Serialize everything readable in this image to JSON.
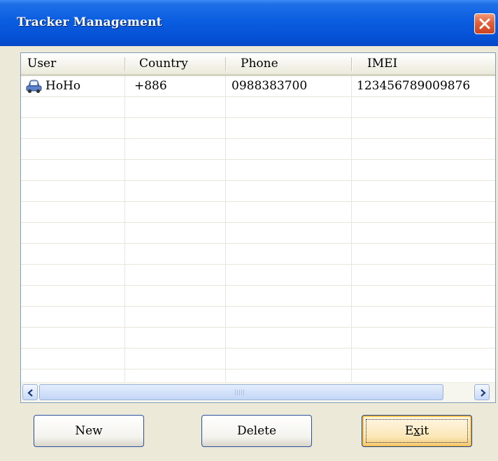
{
  "window": {
    "title": "Tracker Management",
    "close_icon": "close-icon",
    "accent_color": "#0a5de0"
  },
  "list": {
    "columns": [
      "User",
      "Country",
      "Phone",
      "IMEI"
    ],
    "rows": [
      {
        "user": "HoHo",
        "user_icon": "car-icon",
        "country": "+886",
        "phone": "0988383700",
        "imei": "123456789009876"
      }
    ],
    "scrollbar": {
      "left_icon": "chevron-left-icon",
      "right_icon": "chevron-right-icon"
    }
  },
  "buttons": {
    "new_label": "New",
    "delete_label": "Delete",
    "exit_label": "Exit",
    "exit_mnemonic_pre": "E",
    "exit_mnemonic_char": "x",
    "exit_mnemonic_post": "it"
  }
}
